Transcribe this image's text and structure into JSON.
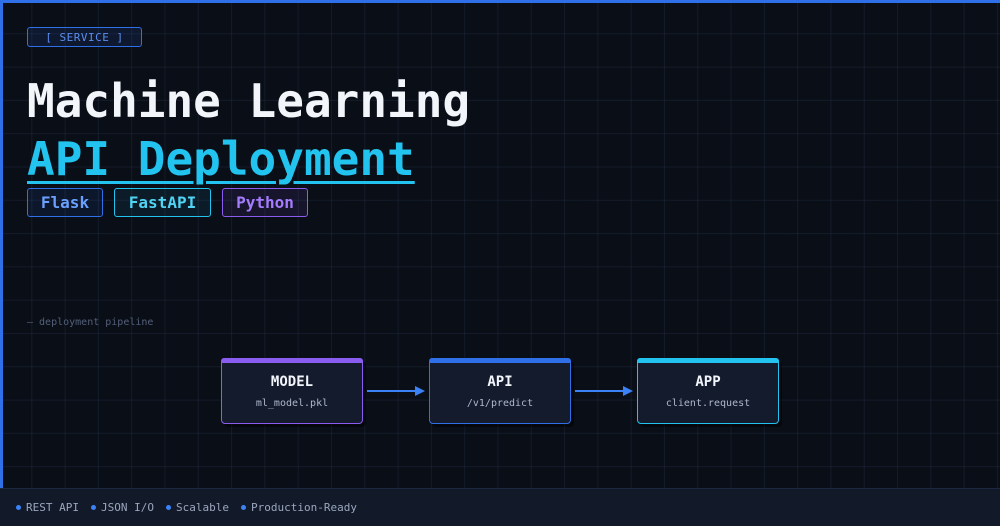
{
  "badge": "[ SERVICE ]",
  "title": {
    "line1": "Machine Learning",
    "line2": "API Deployment"
  },
  "tags": [
    "Flask",
    "FastAPI",
    "Python"
  ],
  "pipeline_label": "— deployment pipeline",
  "nodes": [
    {
      "name": "MODEL",
      "sub": "ml_model.pkl",
      "color": "#8a5cf0"
    },
    {
      "name": "API",
      "sub": "/v1/predict",
      "color": "#2f6fe8"
    },
    {
      "name": "APP",
      "sub": "client.request",
      "color": "#22c3ee"
    }
  ],
  "footer": [
    "REST API",
    "JSON I/O",
    "Scalable",
    "Production-Ready"
  ],
  "colors": {
    "background": "#0a0e17",
    "accent_blue": "#2f6fe8",
    "accent_cyan": "#22c3ee",
    "accent_purple": "#8a5cf0"
  }
}
